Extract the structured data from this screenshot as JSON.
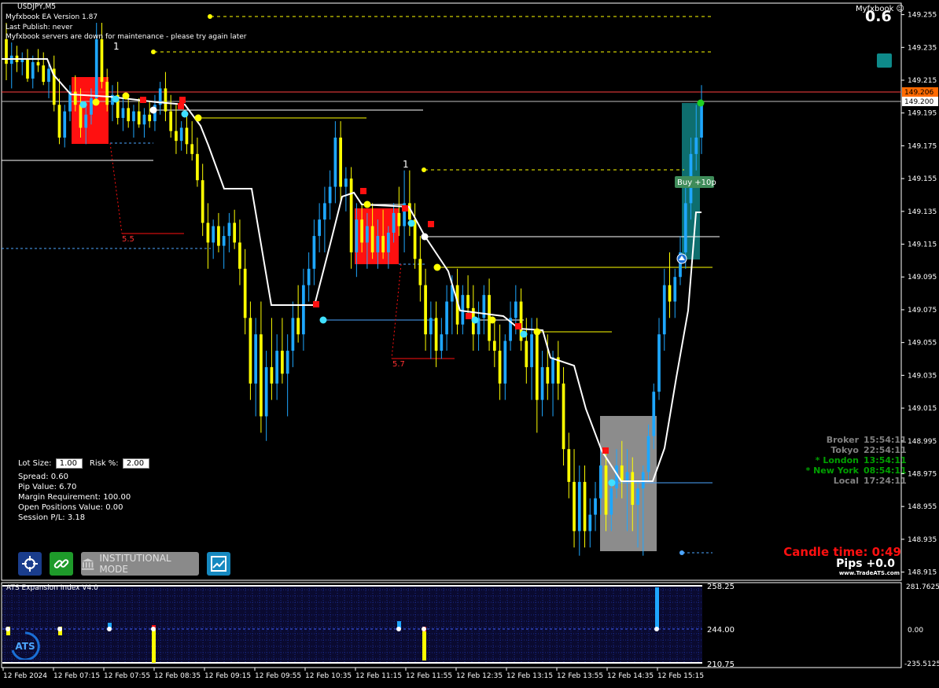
{
  "header": {
    "symbol": "USDJPY,M5",
    "ea_version": "Myfxbook EA Version 1.87",
    "last_publish": "Last Publish: never",
    "status_message": "Myfxbook servers are down for maintenance - please try again later",
    "myfxbook_label": "Myfxbook",
    "spread_big": "0.6"
  },
  "trade_panel": {
    "lot_size_label": "Lot Size:",
    "lot_size_value": "1.00",
    "risk_label": "Risk %:",
    "risk_value": "2.00",
    "spread": "Spread: 0.60",
    "pip_value": "Pip Value: 6.70",
    "margin": "Margin Requirement: 100.00",
    "open_positions": "Open Positions Value: 0.00",
    "session_pl": "Session P/L: 3.18"
  },
  "toolbar": {
    "institutional_mode_label": "INSTITUTIONAL MODE"
  },
  "sessions": [
    {
      "name": "Broker",
      "time": "15:54:11",
      "color": "#808080"
    },
    {
      "name": "Tokyo",
      "time": "22:54:11",
      "color": "#808080"
    },
    {
      "name": "* London",
      "time": "13:54:11",
      "color": "#00a000"
    },
    {
      "name": "* New York",
      "time": "08:54:11",
      "color": "#00a000"
    },
    {
      "name": "Local",
      "time": "17:24:11",
      "color": "#808080"
    }
  ],
  "candle_time": {
    "label": "Candle time:  0:49",
    "pips": "Pips +0.0",
    "brand": "www.TradeATS.com"
  },
  "annotations": {
    "buy_label": "Buy +10p",
    "measure_1": "5.5",
    "measure_2": "5.7",
    "wave_1": "1",
    "wave_2": "1"
  },
  "indicator": {
    "title": "ATS Expansion Index V4.0",
    "levels": [
      "258.25",
      "244.00",
      "210.75"
    ],
    "scale_labels": [
      "281.7625",
      "0.00",
      "-235.5125"
    ]
  },
  "chart_data": {
    "type": "candlestick",
    "symbol": "USDJPY",
    "timeframe": "M5",
    "price_axis_ticks": [
      "149.215",
      "149.175",
      "149.135",
      "149.095",
      "149.055",
      "149.015",
      "148.975",
      "148.935",
      "149.255",
      "149.215",
      "149.175",
      "149.135",
      "149.095",
      "149.055",
      "149.015",
      "148.995",
      "148.975",
      "148.955",
      "148.935",
      "148.915"
    ],
    "y_ticks": [
      149.255,
      149.235,
      149.215,
      149.195,
      149.175,
      149.155,
      149.135,
      149.115,
      149.095,
      149.075,
      149.055,
      149.035,
      149.015,
      148.995,
      148.975,
      148.955,
      148.935,
      148.915
    ],
    "ylim": [
      148.91,
      149.262
    ],
    "bid_price": "149.200",
    "ask_price": "149.206",
    "bid": 149.2,
    "ask": 149.206,
    "x_ticks": [
      "12 Feb 2024",
      "12 Feb 07:15",
      "12 Feb 07:55",
      "12 Feb 08:35",
      "12 Feb 09:15",
      "12 Feb 09:55",
      "12 Feb 10:35",
      "12 Feb 11:15",
      "12 Feb 11:55",
      "12 Feb 12:35",
      "12 Feb 13:15",
      "12 Feb 13:55",
      "12 Feb 14:35",
      "12 Feb 15:15"
    ],
    "candles_ohlc": [
      [
        149.24,
        149.25,
        149.215,
        149.225
      ],
      [
        149.225,
        149.238,
        149.21,
        149.23
      ],
      [
        149.23,
        149.236,
        149.22,
        149.226
      ],
      [
        149.226,
        149.232,
        149.218,
        149.228
      ],
      [
        149.228,
        149.234,
        149.214,
        149.216
      ],
      [
        149.216,
        149.23,
        149.21,
        149.226
      ],
      [
        149.226,
        149.234,
        149.22,
        149.224
      ],
      [
        149.224,
        149.232,
        149.212,
        149.214
      ],
      [
        149.214,
        149.226,
        149.204,
        149.222
      ],
      [
        149.222,
        149.23,
        149.196,
        149.2
      ],
      [
        149.2,
        149.216,
        149.176,
        149.18
      ],
      [
        149.18,
        149.2,
        149.174,
        149.196
      ],
      [
        149.196,
        149.212,
        149.19,
        149.208
      ],
      [
        149.208,
        149.218,
        149.196,
        149.2
      ],
      [
        149.2,
        149.21,
        149.18,
        149.186
      ],
      [
        149.186,
        149.2,
        149.176,
        149.194
      ],
      [
        149.194,
        149.21,
        149.188,
        149.204
      ],
      [
        149.204,
        149.25,
        149.2,
        149.24
      ],
      [
        149.24,
        149.25,
        149.21,
        149.214
      ],
      [
        149.214,
        149.222,
        149.196,
        149.2
      ],
      [
        149.2,
        149.212,
        149.19,
        149.206
      ],
      [
        149.206,
        149.214,
        149.188,
        149.192
      ],
      [
        149.192,
        149.206,
        149.184,
        149.198
      ],
      [
        149.198,
        149.206,
        149.186,
        149.19
      ],
      [
        149.19,
        149.2,
        149.18,
        149.196
      ],
      [
        149.196,
        149.204,
        149.186,
        149.188
      ],
      [
        149.188,
        149.198,
        149.18,
        149.194
      ],
      [
        149.194,
        149.202,
        149.186,
        149.19
      ],
      [
        149.19,
        149.206,
        149.184,
        149.2
      ],
      [
        149.2,
        149.214,
        149.194,
        149.21
      ],
      [
        149.21,
        149.22,
        149.19,
        149.196
      ],
      [
        149.196,
        149.206,
        149.18,
        149.184
      ],
      [
        149.184,
        149.2,
        149.17,
        149.178
      ],
      [
        149.178,
        149.19,
        149.172,
        149.186
      ],
      [
        149.186,
        149.194,
        149.17,
        149.176
      ],
      [
        149.176,
        149.19,
        149.166,
        149.17
      ],
      [
        149.17,
        149.18,
        149.15,
        149.154
      ],
      [
        149.154,
        149.164,
        149.12,
        149.128
      ],
      [
        149.128,
        149.14,
        149.1,
        149.116
      ],
      [
        149.116,
        149.13,
        149.106,
        149.126
      ],
      [
        149.126,
        149.134,
        149.11,
        149.114
      ],
      [
        149.114,
        149.126,
        149.1,
        149.12
      ],
      [
        149.12,
        149.134,
        149.11,
        149.128
      ],
      [
        149.128,
        149.136,
        149.112,
        149.116
      ],
      [
        149.116,
        149.13,
        149.09,
        149.1
      ],
      [
        149.1,
        149.112,
        149.06,
        149.07
      ],
      [
        149.07,
        149.08,
        149.02,
        149.03
      ],
      [
        149.03,
        149.07,
        149.01,
        149.06
      ],
      [
        149.06,
        149.08,
        149.0,
        149.01
      ],
      [
        149.01,
        149.05,
        148.995,
        149.04
      ],
      [
        149.04,
        149.07,
        149.02,
        149.03
      ],
      [
        149.03,
        149.06,
        149.02,
        149.05
      ],
      [
        149.05,
        149.07,
        149.03,
        149.036
      ],
      [
        149.036,
        149.06,
        149.01,
        149.05
      ],
      [
        149.05,
        149.08,
        149.04,
        149.07
      ],
      [
        149.07,
        149.09,
        149.055,
        149.06
      ],
      [
        149.06,
        149.1,
        149.05,
        149.09
      ],
      [
        149.09,
        149.11,
        149.08,
        149.1
      ],
      [
        149.1,
        149.13,
        149.09,
        149.12
      ],
      [
        149.12,
        149.14,
        149.11,
        149.13
      ],
      [
        149.13,
        149.15,
        149.11,
        149.14
      ],
      [
        149.14,
        149.16,
        149.13,
        149.15
      ],
      [
        149.15,
        149.19,
        149.14,
        149.18
      ],
      [
        149.18,
        149.19,
        149.14,
        149.15
      ],
      [
        149.15,
        149.162,
        149.135,
        149.155
      ],
      [
        149.155,
        149.162,
        149.1,
        149.11
      ],
      [
        149.11,
        149.14,
        149.095,
        149.13
      ],
      [
        149.13,
        149.14,
        149.11,
        149.116
      ],
      [
        149.116,
        149.134,
        149.1,
        149.126
      ],
      [
        149.126,
        149.14,
        149.106,
        149.11
      ],
      [
        149.11,
        149.13,
        149.1,
        149.12
      ],
      [
        149.12,
        149.136,
        149.106,
        149.11
      ],
      [
        149.11,
        149.126,
        149.1,
        149.122
      ],
      [
        149.122,
        149.14,
        149.116,
        149.134
      ],
      [
        149.134,
        149.15,
        149.12,
        149.126
      ],
      [
        149.126,
        149.16,
        149.11,
        149.14
      ],
      [
        149.14,
        149.16,
        149.12,
        149.13
      ],
      [
        149.13,
        149.14,
        149.1,
        149.106
      ],
      [
        149.106,
        149.12,
        149.08,
        149.09
      ],
      [
        149.09,
        149.1,
        149.05,
        149.06
      ],
      [
        149.06,
        149.08,
        149.045,
        149.07
      ],
      [
        149.07,
        149.08,
        149.04,
        149.05
      ],
      [
        149.05,
        149.07,
        149.045,
        149.06
      ],
      [
        149.06,
        149.09,
        149.05,
        149.08
      ],
      [
        149.08,
        149.096,
        149.06,
        149.09
      ],
      [
        149.09,
        149.1,
        149.06,
        149.066
      ],
      [
        149.066,
        149.09,
        149.06,
        149.084
      ],
      [
        149.084,
        149.096,
        149.07,
        149.076
      ],
      [
        149.076,
        149.09,
        149.05,
        149.06
      ],
      [
        149.06,
        149.08,
        149.05,
        149.07
      ],
      [
        149.07,
        149.09,
        149.06,
        149.084
      ],
      [
        149.084,
        149.094,
        149.05,
        149.056
      ],
      [
        149.056,
        149.07,
        149.04,
        149.05
      ],
      [
        149.05,
        149.066,
        149.02,
        149.03
      ],
      [
        149.03,
        149.06,
        149.02,
        149.056
      ],
      [
        149.056,
        149.08,
        149.05,
        149.07
      ],
      [
        149.07,
        149.09,
        149.06,
        149.08
      ],
      [
        149.08,
        149.088,
        149.05,
        149.056
      ],
      [
        149.056,
        149.07,
        149.03,
        149.04
      ],
      [
        149.04,
        149.07,
        149.02,
        149.06
      ],
      [
        149.06,
        149.07,
        149.0,
        149.02
      ],
      [
        149.02,
        149.05,
        149.01,
        149.04
      ],
      [
        149.04,
        149.06,
        149.02,
        149.03
      ],
      [
        149.03,
        149.05,
        149.01,
        149.046
      ],
      [
        149.046,
        149.056,
        149.02,
        149.03
      ],
      [
        149.03,
        149.04,
        148.98,
        148.99
      ],
      [
        148.99,
        149.0,
        148.96,
        148.97
      ],
      [
        148.97,
        148.99,
        148.93,
        148.94
      ],
      [
        148.94,
        148.98,
        148.925,
        148.97
      ],
      [
        148.97,
        148.98,
        148.93,
        148.94
      ],
      [
        148.94,
        148.96,
        148.93,
        148.95
      ],
      [
        148.95,
        148.97,
        148.94,
        148.96
      ],
      [
        148.96,
        148.99,
        148.95,
        148.98
      ],
      [
        148.98,
        148.99,
        148.94,
        148.95
      ],
      [
        148.95,
        148.97,
        148.94,
        148.966
      ],
      [
        148.966,
        148.99,
        148.96,
        148.98
      ],
      [
        148.98,
        148.995,
        148.96,
        148.97
      ],
      [
        148.97,
        148.99,
        148.94,
        148.976
      ],
      [
        148.976,
        148.985,
        148.94,
        148.956
      ],
      [
        148.956,
        148.97,
        148.93,
        148.966
      ],
      [
        148.966,
        148.98,
        148.925,
        148.976
      ],
      [
        148.976,
        149.005,
        148.97,
        148.998
      ],
      [
        148.998,
        149.03,
        148.99,
        149.025
      ],
      [
        149.025,
        149.07,
        149.02,
        149.06
      ],
      [
        149.06,
        149.1,
        149.05,
        149.09
      ],
      [
        149.09,
        149.11,
        149.07,
        149.08
      ],
      [
        149.08,
        149.1,
        149.07,
        149.095
      ],
      [
        149.095,
        149.12,
        149.09,
        149.11
      ],
      [
        149.11,
        149.15,
        149.1,
        149.14
      ],
      [
        149.14,
        149.18,
        149.13,
        149.17
      ],
      [
        149.17,
        149.2,
        149.16,
        149.18
      ],
      [
        149.18,
        149.212,
        149.17,
        149.2
      ]
    ]
  }
}
